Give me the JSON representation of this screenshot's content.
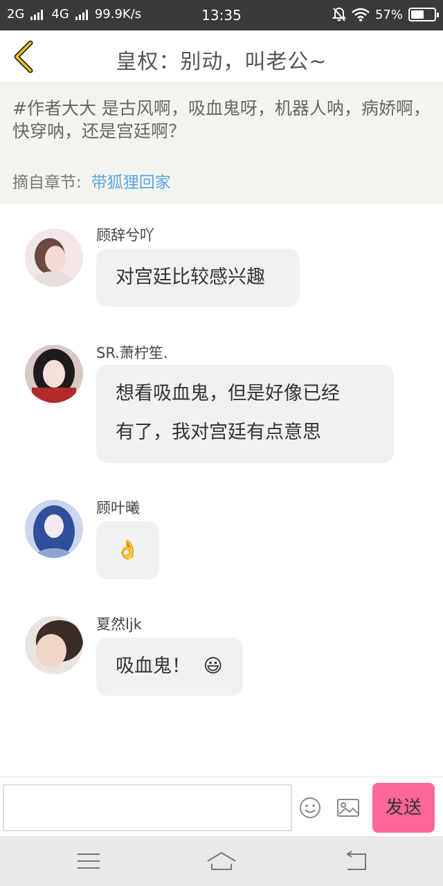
{
  "status_bar": {
    "network_left": "2G",
    "network_right": "4G",
    "speed": "99.9K/s",
    "time": "13:35",
    "battery_percent": "57%",
    "battery_level": 0.57,
    "icons": [
      "signal-icon",
      "mute-bell-icon",
      "wifi-icon",
      "battery-icon"
    ]
  },
  "header": {
    "title": "皇权：别动，叫老公~",
    "back_icon": "chevron-left-icon",
    "accent_color": "#e6b800"
  },
  "topic": {
    "text": "#作者大大 是古风啊，吸血鬼呀，机器人呐，病娇啊，快穿呐，还是宫廷啊？",
    "source_label": "摘自章节:",
    "source_link": "带狐狸回家",
    "link_color": "#5aa6e0"
  },
  "messages": [
    {
      "username": "顾辞兮吖",
      "text": "对宫廷比较感兴趣"
    },
    {
      "username": "SR.萧柠笙.",
      "text_line1": "想看吸血鬼，但是好像已经",
      "text_line2": "有了，我对宫廷有点意思"
    },
    {
      "username": "顾叶曦",
      "text": "👌"
    },
    {
      "username": "夏然ljk",
      "text": "吸血鬼！",
      "emoji": "😃"
    }
  ],
  "input_bar": {
    "placeholder": "",
    "emoji_icon": "smiley-icon",
    "image_icon": "image-icon",
    "send_label": "发送",
    "send_color": "#ff6699"
  },
  "nav_bar": {
    "icons": [
      "menu-icon",
      "home-icon",
      "back-icon"
    ]
  }
}
